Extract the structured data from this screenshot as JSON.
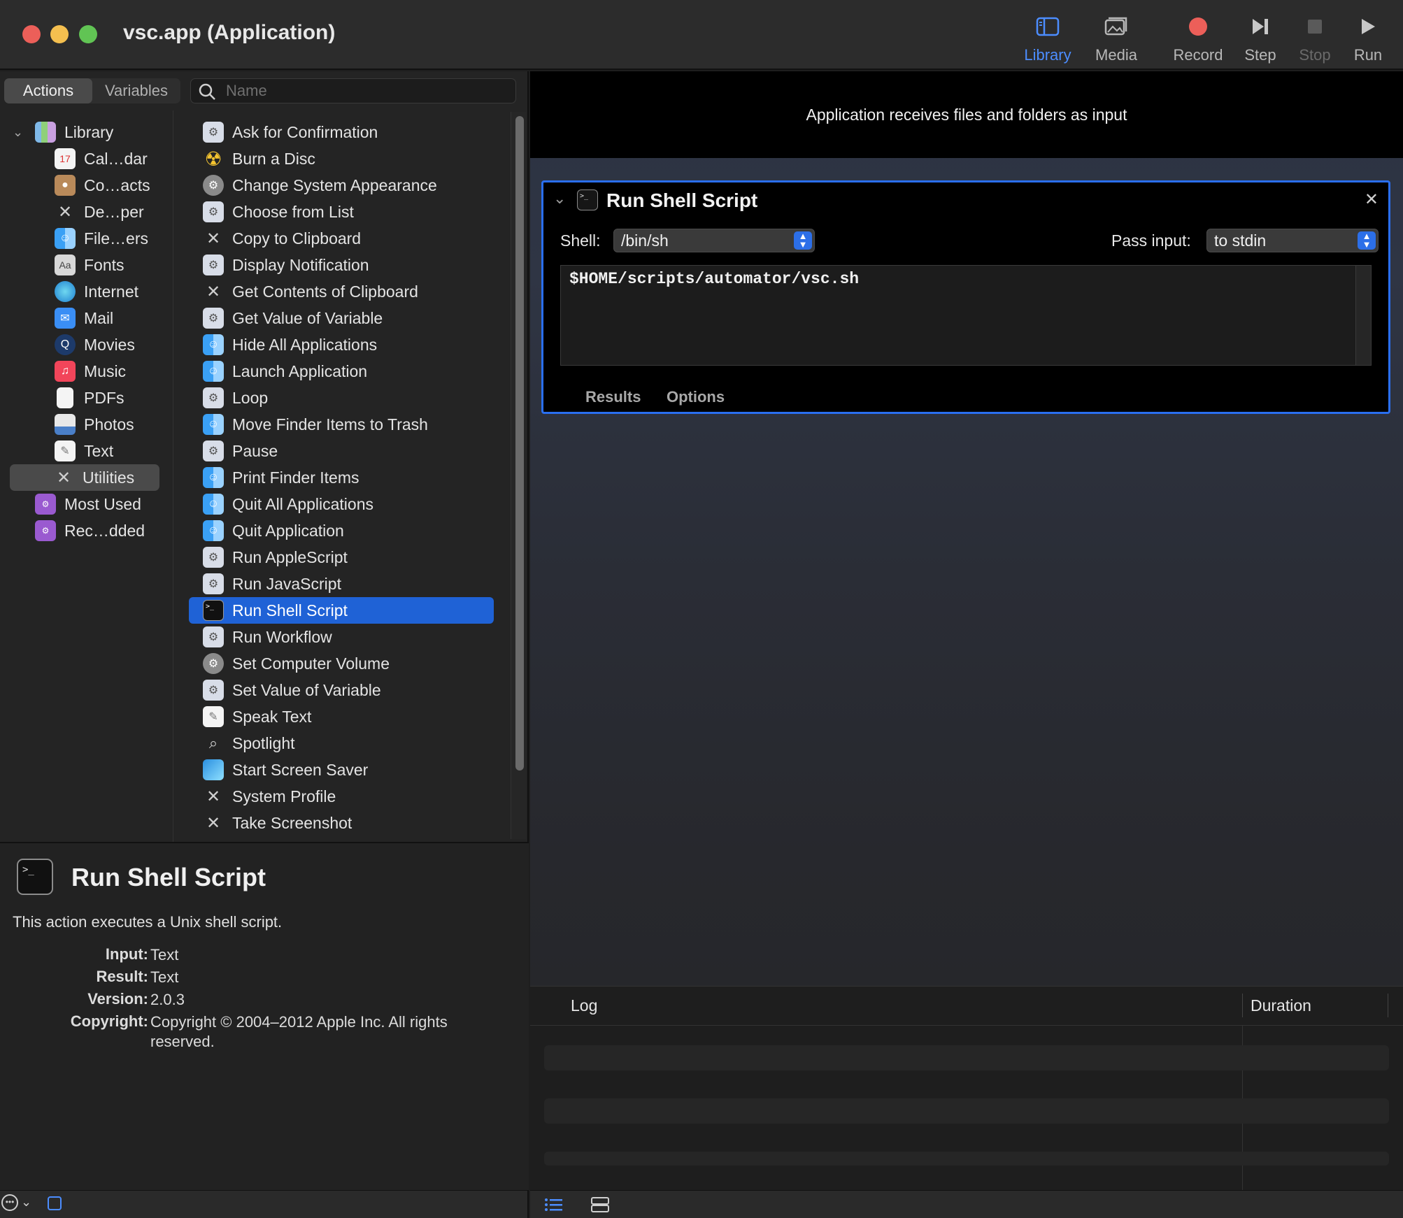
{
  "window": {
    "title": "vsc.app (Application)"
  },
  "toolbar": {
    "library": "Library",
    "media": "Media",
    "record": "Record",
    "step": "Step",
    "stop": "Stop",
    "run": "Run"
  },
  "tabs": {
    "actions": "Actions",
    "variables": "Variables"
  },
  "search": {
    "placeholder": "Name",
    "value": ""
  },
  "library": {
    "root": "Library",
    "items": [
      "Cal…dar",
      "Co…acts",
      "De…per",
      "File…ers",
      "Fonts",
      "Internet",
      "Mail",
      "Movies",
      "Music",
      "PDFs",
      "Photos",
      "Text",
      "Utilities"
    ],
    "selected": "Utilities",
    "extra": [
      "Most Used",
      "Rec…dded"
    ]
  },
  "actions": {
    "items": [
      "Ask for Confirmation",
      "Burn a Disc",
      "Change System Appearance",
      "Choose from List",
      "Copy to Clipboard",
      "Display Notification",
      "Get Contents of Clipboard",
      "Get Value of Variable",
      "Hide All Applications",
      "Launch Application",
      "Loop",
      "Move Finder Items to Trash",
      "Pause",
      "Print Finder Items",
      "Quit All Applications",
      "Quit Application",
      "Run AppleScript",
      "Run JavaScript",
      "Run Shell Script",
      "Run Workflow",
      "Set Computer Volume",
      "Set Value of Variable",
      "Speak Text",
      "Spotlight",
      "Start Screen Saver",
      "System Profile",
      "Take Screenshot"
    ],
    "selected": "Run Shell Script"
  },
  "description": {
    "title": "Run Shell Script",
    "text": "This action executes a Unix shell script.",
    "input_label": "Input:",
    "input": "Text",
    "result_label": "Result:",
    "result": "Text",
    "version_label": "Version:",
    "version": "2.0.3",
    "copyright_label": "Copyright:",
    "copyright": "Copyright © 2004–2012 Apple Inc.  All rights reserved."
  },
  "workflow": {
    "banner": "Application receives files and folders as input",
    "card": {
      "title": "Run Shell Script",
      "shell_label": "Shell:",
      "shell_value": "/bin/sh",
      "pass_label": "Pass input:",
      "pass_value": "to stdin",
      "script": "$HOME/scripts/automator/vsc.sh",
      "tab_results": "Results",
      "tab_options": "Options"
    }
  },
  "log": {
    "col_log": "Log",
    "col_duration": "Duration"
  },
  "colors": {
    "accent": "#1f62d6",
    "card_border": "#2a6ff0"
  }
}
